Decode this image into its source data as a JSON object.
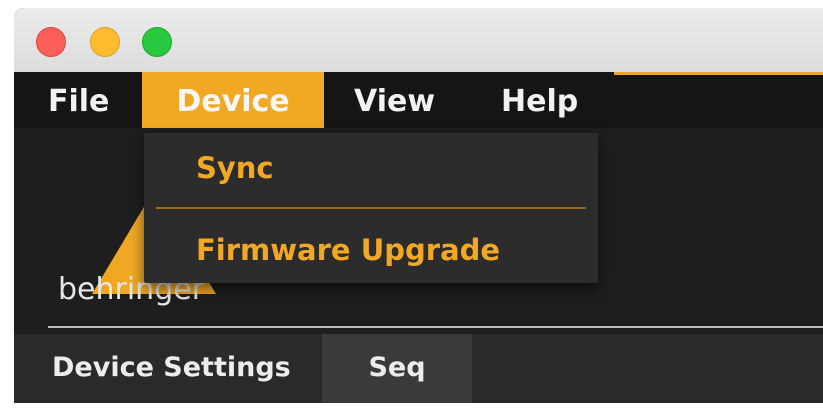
{
  "window": {
    "controls": [
      "close",
      "minimize",
      "zoom"
    ]
  },
  "menubar": {
    "items": [
      {
        "label": "File"
      },
      {
        "label": "Device"
      },
      {
        "label": "View"
      },
      {
        "label": "Help"
      }
    ],
    "active": "Device",
    "accent_color": "#f3a824"
  },
  "device_menu": {
    "items": [
      {
        "label": "Sync"
      },
      {
        "label": "Firmware Upgrade"
      }
    ]
  },
  "logo": {
    "text": "behringer"
  },
  "tabs": [
    {
      "label": "Device Settings"
    },
    {
      "label": "Seq"
    }
  ]
}
